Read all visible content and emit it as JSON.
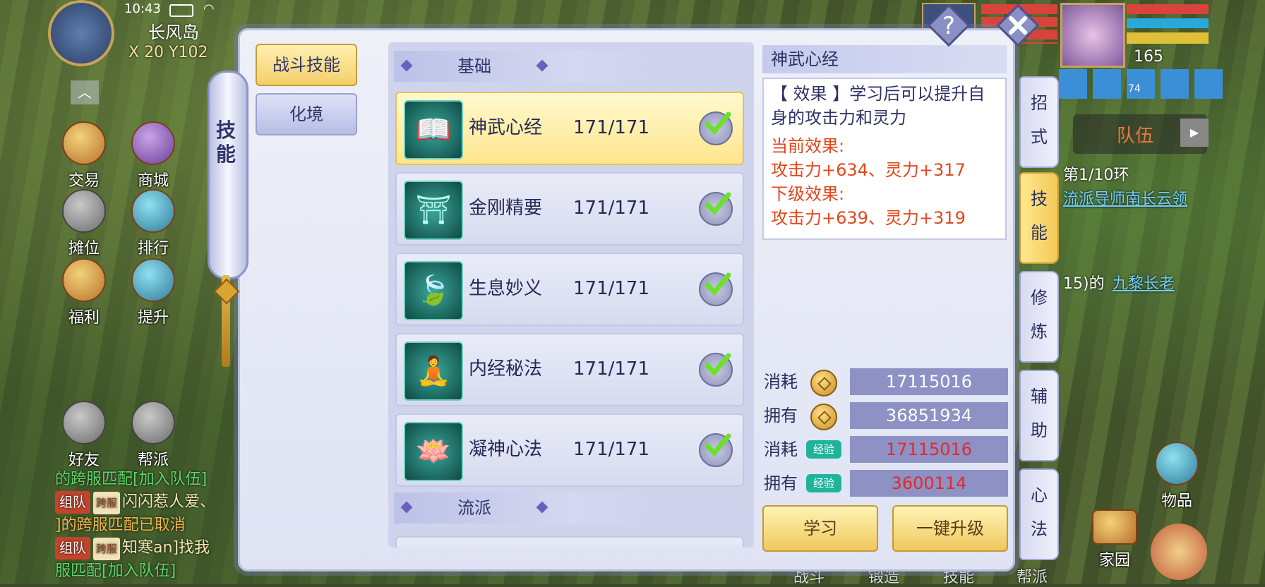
{
  "status": {
    "time": "10:43"
  },
  "map": {
    "name": "长风岛",
    "coords": "X 20  Y102"
  },
  "hud": {
    "left_buttons": [
      {
        "label": "交易",
        "icon": "trade-icon"
      },
      {
        "label": "商城",
        "icon": "shop-icon"
      },
      {
        "label": "摊位",
        "icon": "stall-icon"
      },
      {
        "label": "排行",
        "icon": "ranking-icon"
      },
      {
        "label": "福利",
        "icon": "welfare-icon"
      },
      {
        "label": "提升",
        "icon": "improve-icon"
      },
      {
        "label": "好友",
        "icon": "friends-icon"
      },
      {
        "label": "帮派",
        "icon": "guild-voice-icon"
      }
    ],
    "player_level": "165",
    "buff_count": "74",
    "team_label": "队伍",
    "quest_progress": "第1/10环",
    "quest_line": "流派导师南长云领",
    "quest_line2_num": "15)的",
    "quest_line2_name": "九黎长老",
    "bottom_right": {
      "items": "物品",
      "home": "家园"
    },
    "bottom_hidden": [
      "战斗",
      "锻造",
      "技能",
      "帮派"
    ]
  },
  "chat": {
    "line0": "的跨服匹配[加入队伍]",
    "line1_tag": "组队",
    "line1_cross": "跨服",
    "line1_text": "闪闪惹人爱、",
    "line2": "]的跨服匹配已取消",
    "line3_tag": "组队",
    "line3_cross": "跨服",
    "line3_text": "知寒an]找我",
    "line4": "服匹配[加入队伍]"
  },
  "scroll_label": "技能",
  "left_tabs": [
    {
      "label": "战斗技能",
      "active": true
    },
    {
      "label": "化境",
      "active": false
    }
  ],
  "sections": {
    "basic": "基础",
    "school": "流派"
  },
  "skills": [
    {
      "name": "神武心经",
      "level": "171/171",
      "glyph": "📖",
      "selected": true
    },
    {
      "name": "金刚精要",
      "level": "171/171",
      "glyph": "⛩",
      "selected": false
    },
    {
      "name": "生息妙义",
      "level": "171/171",
      "glyph": "🍃",
      "selected": false
    },
    {
      "name": "内经秘法",
      "level": "171/171",
      "glyph": "🧘",
      "selected": false
    },
    {
      "name": "凝神心法",
      "level": "171/171",
      "glyph": "🪷",
      "selected": false
    }
  ],
  "detail": {
    "title": "神武心经",
    "effect": "【 效果 】学习后可以提升自身的攻击力和灵力",
    "current_label": "当前效果:",
    "current_value": "攻击力+634、灵力+317",
    "next_label": "下级效果:",
    "next_value": "攻击力+639、灵力+319"
  },
  "costs": [
    {
      "label": "消耗",
      "type": "coin",
      "value": "17115016",
      "red": false
    },
    {
      "label": "拥有",
      "type": "coin",
      "value": "36851934",
      "red": false
    },
    {
      "label": "消耗",
      "type": "exp",
      "tag": "经验",
      "value": "17115016",
      "red": true
    },
    {
      "label": "拥有",
      "type": "exp",
      "tag": "经验",
      "value": "3600114",
      "red": true
    }
  ],
  "buttons": {
    "learn": "学习",
    "upgrade_all": "一键升级"
  },
  "right_tabs": [
    {
      "label": "招式",
      "active": false
    },
    {
      "label": "技能",
      "active": true
    },
    {
      "label": "修炼",
      "active": false
    },
    {
      "label": "辅助",
      "active": false
    },
    {
      "label": "心法",
      "active": false
    }
  ],
  "colors": {
    "accent_gold": "#f3cf6a",
    "panel": "#e3e6f4",
    "effect_red": "#e4461c"
  }
}
